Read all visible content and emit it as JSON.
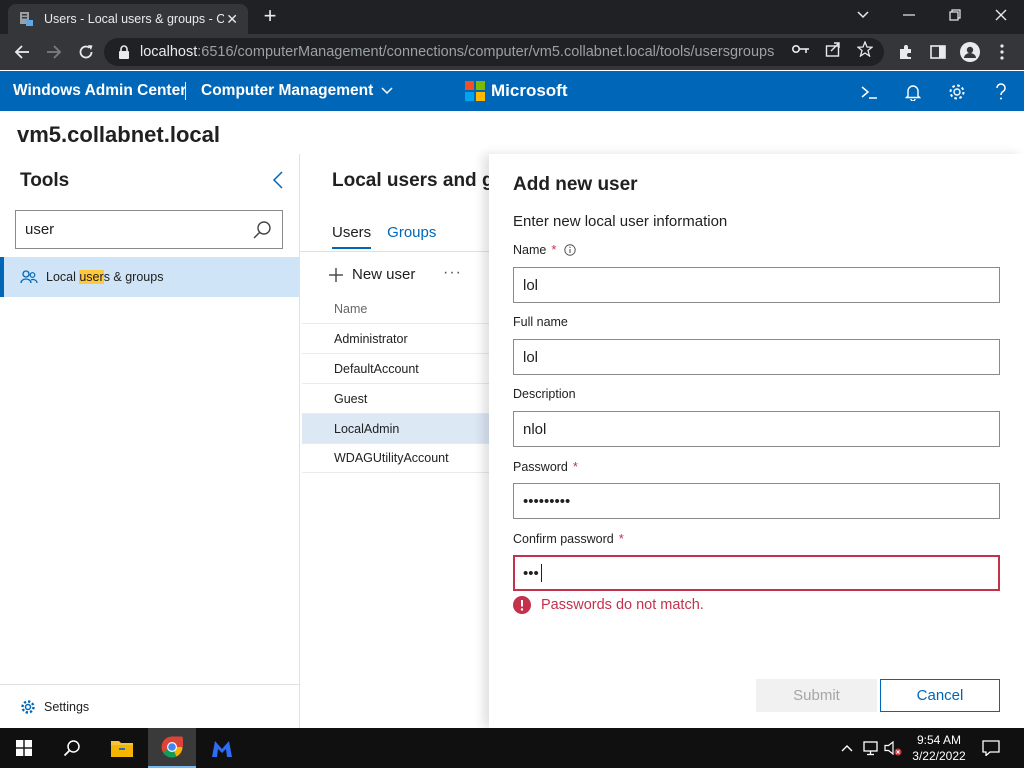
{
  "browser": {
    "tab_title": "Users - Local users & groups - Co",
    "url_host": "localhost",
    "url_rest": ":6516/computerManagement/connections/computer/vm5.collabnet.local/tools/usersgroups"
  },
  "header": {
    "app_title": "Windows Admin Center",
    "section": "Computer Management",
    "brand": "Microsoft",
    "brand_colors": [
      "#f25022",
      "#7fba00",
      "#00a4ef",
      "#ffb900"
    ]
  },
  "server_name": "vm5.collabnet.local",
  "tools": {
    "title": "Tools",
    "search_value": "user",
    "item_prefix": "Local ",
    "item_highlight": "user",
    "item_suffix": "s & groups",
    "settings": "Settings"
  },
  "main": {
    "title": "Local users and groups",
    "tabs": [
      "Users",
      "Groups"
    ],
    "new_user": "New user",
    "more": "···",
    "column_name": "Name",
    "rows": [
      "Administrator",
      "DefaultAccount",
      "Guest",
      "LocalAdmin",
      "WDAGUtilityAccount"
    ]
  },
  "panel": {
    "title": "Add new user",
    "subtitle": "Enter new local user information",
    "name_label": "Name",
    "name_value": "lol",
    "fullname_label": "Full name",
    "fullname_value": "lol",
    "description_label": "Description",
    "description_value": "nlol",
    "password_label": "Password",
    "password_value": "•••••••••",
    "confirm_label": "Confirm password",
    "confirm_value": "•••",
    "required_mark": "*",
    "error_text": "Passwords do not match.",
    "submit": "Submit",
    "cancel": "Cancel"
  },
  "taskbar": {
    "time": "9:54 AM",
    "date": "3/22/2022"
  },
  "colors": {
    "accent": "#0067b8",
    "error": "#c4314b"
  }
}
